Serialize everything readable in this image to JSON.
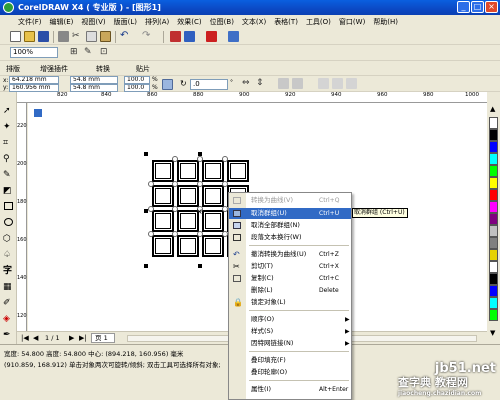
{
  "window": {
    "title": "CorelDRAW X4 ( 专业版 ) - [图形1]",
    "min": "_",
    "max": "□",
    "close": "×"
  },
  "menubar": [
    "文件(F)",
    "编辑(E)",
    "视图(V)",
    "版面(L)",
    "排列(A)",
    "效果(C)",
    "位图(B)",
    "文本(X)",
    "表格(T)",
    "工具(O)",
    "窗口(W)",
    "帮助(H)"
  ],
  "toolbar": {
    "zoom": "100%",
    "tabs": [
      "排版",
      "增强插件",
      "转换",
      "贴片"
    ]
  },
  "propertybar": {
    "x": "64.218 mm",
    "y": "160.956 mm",
    "w": "54.8 mm",
    "h": "54.8 mm",
    "sx": "100.0",
    "sy": "100.0",
    "pct": "%",
    "angle": ".0",
    "deg": "°"
  },
  "ruler": {
    "labels": [
      "820",
      "840",
      "860",
      "880",
      "900",
      "920",
      "940",
      "960",
      "980",
      "1000"
    ],
    "left_labels": [
      "220",
      "200",
      "180",
      "160",
      "140",
      "120"
    ]
  },
  "context_menu": {
    "items": [
      {
        "label": "转换为曲线(V)",
        "shortcut": "Ctrl+Q",
        "disabled": true
      },
      {
        "label": "取消群组(U)",
        "shortcut": "Ctrl+U",
        "highlighted": true
      },
      {
        "label": "取消全部群组(N)",
        "shortcut": ""
      },
      {
        "label": "段落文本换行(W)",
        "shortcut": ""
      },
      {
        "label": "撤消转换为曲线(U)",
        "shortcut": "Ctrl+Z"
      },
      {
        "label": "剪切(T)",
        "shortcut": "Ctrl+X"
      },
      {
        "label": "复制(C)",
        "shortcut": "Ctrl+C"
      },
      {
        "label": "删除(L)",
        "shortcut": "Delete"
      },
      {
        "label": "锁定对象(L)",
        "shortcut": ""
      },
      {
        "label": "顺序(O)",
        "shortcut": "",
        "submenu": true
      },
      {
        "label": "样式(S)",
        "shortcut": "",
        "submenu": true
      },
      {
        "label": "因特网链接(N)",
        "shortcut": "",
        "submenu": true
      },
      {
        "label": "叠印填充(F)",
        "shortcut": ""
      },
      {
        "label": "叠印轮廓(O)",
        "shortcut": ""
      },
      {
        "label": "属性(I)",
        "shortcut": "Alt+Enter"
      }
    ]
  },
  "tooltip": "取消群组 (Ctrl+U)",
  "pagebar": {
    "counter": "1 / 1",
    "page": "页 1"
  },
  "status": {
    "line1": "宽度: 54.800  高度: 54.800  中心: (894.218, 160.956)  毫米",
    "line2": "(910.859, 168.912)   单击对象两次可旋转/倾斜; 双击工具可选择所有对象;"
  },
  "watermark": {
    "line1": "jb51.net",
    "line2": "查字典 教程网",
    "line3": "jiaocheng.chazidian.com"
  },
  "colors": {
    "title_blue": "#0B49C4",
    "menu_highlight": "#316AC5",
    "palette": [
      "#FFFFFF",
      "#000000",
      "#0000FF",
      "#00FFFF",
      "#00FF00",
      "#FFFF00",
      "#FF0000",
      "#FF00FF",
      "#800080",
      "#C0C0C0",
      "#808080",
      "#E6D200"
    ]
  },
  "icons": [
    "app-icon",
    "new-icon",
    "open-icon",
    "save-icon",
    "print-icon",
    "cut-icon",
    "copy-icon",
    "paste-icon",
    "undo-icon",
    "redo-icon",
    "import-icon",
    "export-icon",
    "pick-tool-icon",
    "shape-tool-icon",
    "zoom-tool-icon",
    "rectangle-tool-icon",
    "ellipse-tool-icon",
    "text-tool-icon",
    "fill-tool-icon"
  ]
}
